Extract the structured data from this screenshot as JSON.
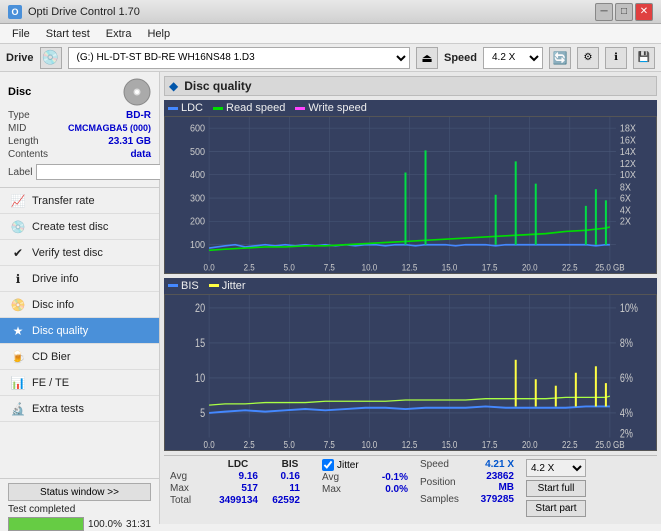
{
  "titleBar": {
    "title": "Opti Drive Control 1.70",
    "icon": "O",
    "controls": [
      "─",
      "□",
      "✕"
    ]
  },
  "menuBar": {
    "items": [
      "File",
      "Start test",
      "Extra",
      "Help"
    ]
  },
  "driveBar": {
    "label": "Drive",
    "driveValue": "(G:)  HL-DT-ST BD-RE  WH16NS48 1.D3",
    "speedLabel": "Speed",
    "speedValue": "4.2 X"
  },
  "disc": {
    "typeLabel": "Type",
    "typeValue": "BD-R",
    "midLabel": "MID",
    "midValue": "CMCMAGBA5 (000)",
    "lengthLabel": "Length",
    "lengthValue": "23.31 GB",
    "contentsLabel": "Contents",
    "contentsValue": "data",
    "labelLabel": "Label",
    "labelValue": ""
  },
  "nav": {
    "items": [
      {
        "id": "transfer-rate",
        "label": "Transfer rate",
        "icon": "📈"
      },
      {
        "id": "create-test-disc",
        "label": "Create test disc",
        "icon": "💿"
      },
      {
        "id": "verify-test-disc",
        "label": "Verify test disc",
        "icon": "✔"
      },
      {
        "id": "drive-info",
        "label": "Drive info",
        "icon": "ℹ"
      },
      {
        "id": "disc-info",
        "label": "Disc info",
        "icon": "📀"
      },
      {
        "id": "disc-quality",
        "label": "Disc quality",
        "icon": "★",
        "active": true
      },
      {
        "id": "cd-bier",
        "label": "CD Bier",
        "icon": "🍺"
      },
      {
        "id": "fe-te",
        "label": "FE / TE",
        "icon": "📊"
      },
      {
        "id": "extra-tests",
        "label": "Extra tests",
        "icon": "🔬"
      }
    ]
  },
  "statusWindow": {
    "buttonLabel": "Status window >>",
    "statusText": "Test completed",
    "progress": 100,
    "progressText": "100.0%",
    "time": "31:31"
  },
  "chart": {
    "title": "Disc quality",
    "icon": "◆",
    "topChart": {
      "legend": [
        {
          "label": "LDC",
          "color": "#4488ff"
        },
        {
          "label": "Read speed",
          "color": "#00dd00"
        },
        {
          "label": "Write speed",
          "color": "#ff44ff"
        }
      ],
      "yMax": 600,
      "yLabels": [
        "600",
        "500",
        "400",
        "300",
        "200",
        "100",
        "0"
      ],
      "yRightLabels": [
        "18X",
        "16X",
        "14X",
        "12X",
        "10X",
        "8X",
        "6X",
        "4X",
        "2X"
      ],
      "xLabels": [
        "0.0",
        "2.5",
        "5.0",
        "7.5",
        "10.0",
        "12.5",
        "15.0",
        "17.5",
        "20.0",
        "22.5",
        "25.0 GB"
      ]
    },
    "bottomChart": {
      "legend": [
        {
          "label": "BIS",
          "color": "#4488ff"
        },
        {
          "label": "Jitter",
          "color": "#ffff00"
        }
      ],
      "yMax": 20,
      "yLabels": [
        "20",
        "15",
        "10",
        "5",
        "0"
      ],
      "yRightLabels": [
        "10%",
        "8%",
        "6%",
        "4%",
        "2%"
      ],
      "xLabels": [
        "0.0",
        "2.5",
        "5.0",
        "7.5",
        "10.0",
        "12.5",
        "15.0",
        "17.5",
        "20.0",
        "22.5",
        "25.0 GB"
      ]
    }
  },
  "stats": {
    "columns": [
      "LDC",
      "BIS"
    ],
    "jitterLabel": "Jitter",
    "jitterChecked": true,
    "rows": [
      {
        "label": "Avg",
        "ldc": "9.16",
        "bis": "0.16",
        "jitter": "-0.1%"
      },
      {
        "label": "Max",
        "ldc": "517",
        "bis": "11",
        "jitter": "0.0%"
      },
      {
        "label": "Total",
        "ldc": "3499134",
        "bis": "62592",
        "jitter": ""
      }
    ],
    "speed": {
      "label": "Speed",
      "value": "4.21 X",
      "positionLabel": "Position",
      "positionValue": "23862 MB",
      "samplesLabel": "Samples",
      "samplesValue": "379285"
    },
    "speedDropdown": "4.2 X",
    "buttons": [
      "Start full",
      "Start part"
    ]
  }
}
